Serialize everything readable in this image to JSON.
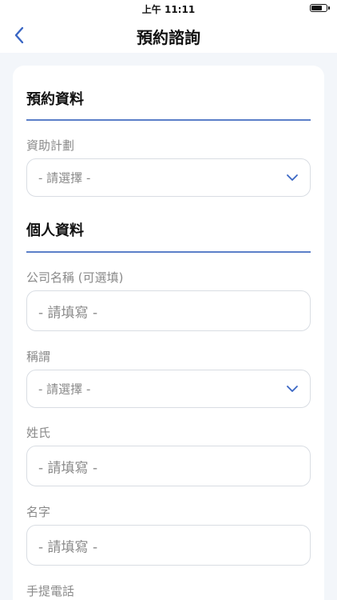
{
  "status_bar": {
    "time": "上午 11:11"
  },
  "nav": {
    "title": "預約諮詢",
    "back_icon": "chevron-left-icon"
  },
  "sections": {
    "booking": {
      "title": "預約資料"
    },
    "personal": {
      "title": "個人資料"
    }
  },
  "fields": {
    "plan": {
      "label": "資助計劃",
      "value": "- 請選擇 -"
    },
    "company": {
      "label": "公司名稱 (可選填)",
      "placeholder": "- 請填寫 -"
    },
    "salutation": {
      "label": "稱謂",
      "value": "- 請選擇 -"
    },
    "surname": {
      "label": "姓氏",
      "placeholder": "- 請填寫 -"
    },
    "given_name": {
      "label": "名字",
      "placeholder": "- 請填寫 -"
    },
    "mobile": {
      "label": "手提電話"
    }
  },
  "colors": {
    "accent": "#3a66c4",
    "divider": "#5b7fc9",
    "background": "#f3f6fa",
    "label": "#8a8a8a"
  }
}
